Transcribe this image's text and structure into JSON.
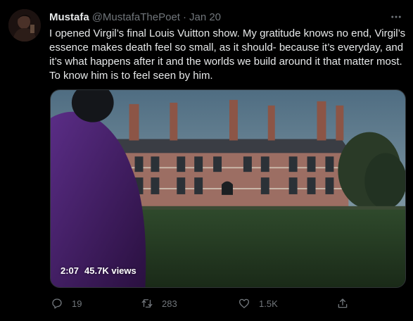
{
  "author": {
    "display_name": "Mustafa",
    "handle": "@MustafaThePoet",
    "separator": "·",
    "date": "Jan 20"
  },
  "tweet": {
    "text": "I opened Virgil’s final Louis Vuitton show. My gratitude knows no end, Virgil’s essence makes death feel so small, as it should- because it’s everyday, and it’s what happens after it and the worlds we build around it that matter most. To know him is to feel seen by him."
  },
  "media": {
    "duration": "2:07",
    "views": "45.7K views"
  },
  "actions": {
    "replies": "19",
    "retweets": "283",
    "likes": "1.5K"
  },
  "icons": {
    "avatar": "avatar-image",
    "more": "more-icon",
    "reply": "reply-icon",
    "retweet": "retweet-icon",
    "like": "heart-icon",
    "share": "share-icon"
  },
  "colors": {
    "background": "#000000",
    "text_primary": "#e7e9ea",
    "text_secondary": "#71767b",
    "border": "#2f3336"
  }
}
